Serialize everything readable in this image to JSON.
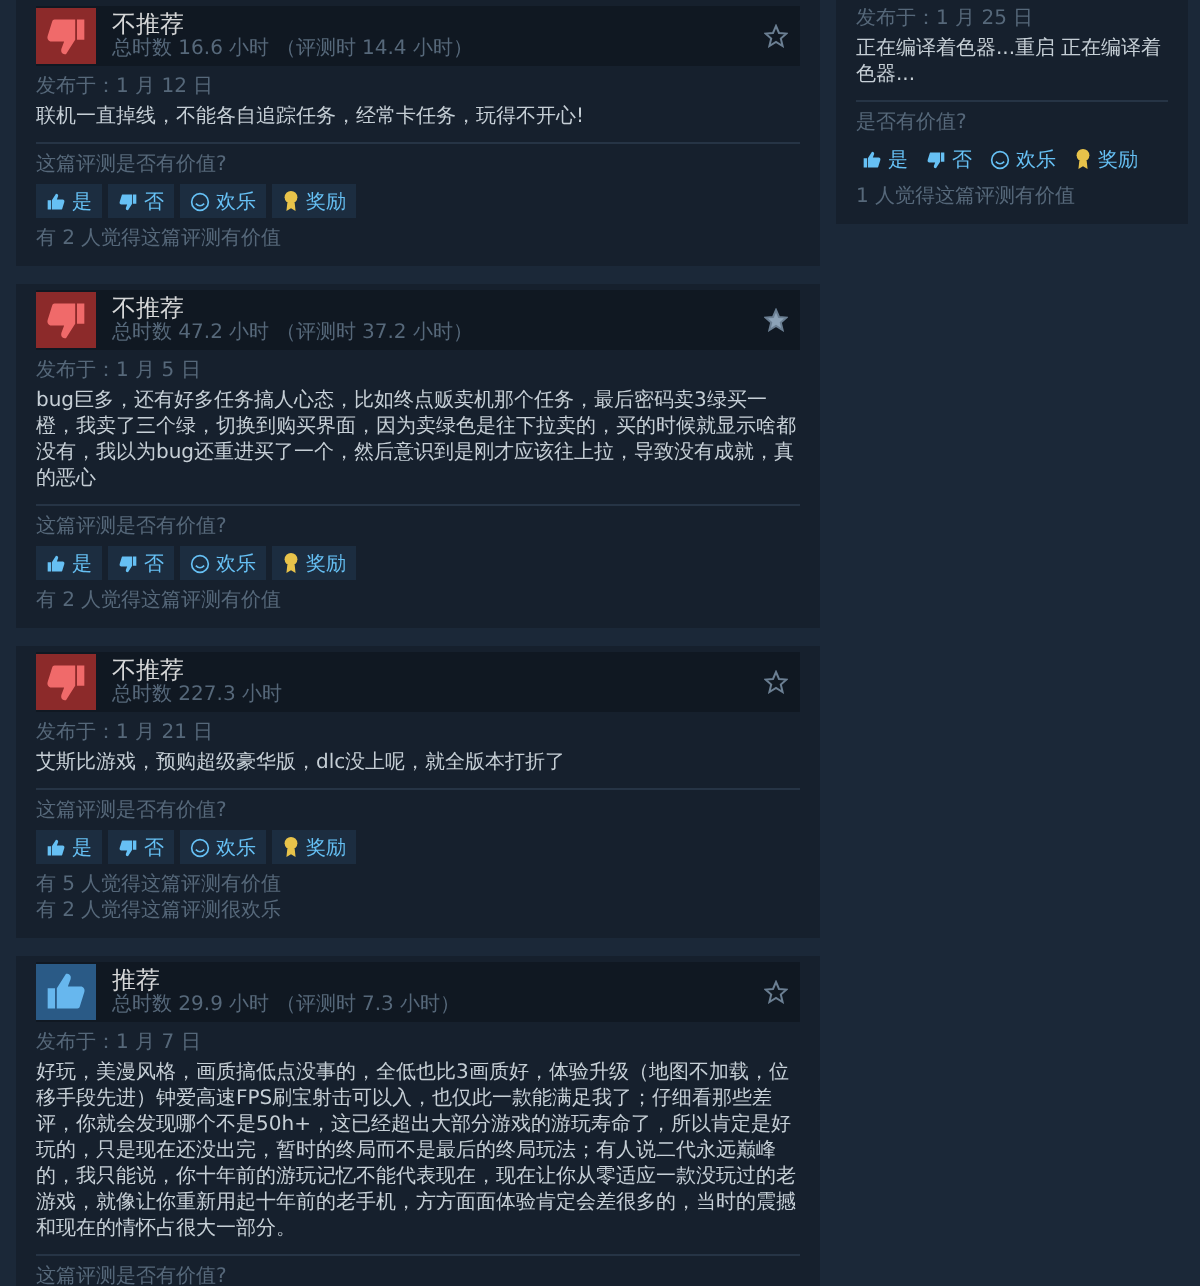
{
  "reviews": [
    {
      "recommended": false,
      "verdict": "不推荐",
      "hours": "总时数 16.6 小时 （评测时 14.4 小时）",
      "starred": false,
      "date": "发布于：1 月 12 日",
      "text": "联机一直掉线，不能各自追踪任务，经常卡任务，玩得不开心!",
      "question": "这篇评测是否有价值?",
      "buttons": [
        "是",
        "否",
        "欢乐",
        "奖励"
      ],
      "counts": [
        "有 2 人觉得这篇评测有价值"
      ]
    },
    {
      "recommended": false,
      "verdict": "不推荐",
      "hours": "总时数 47.2 小时 （评测时 37.2 小时）",
      "starred": true,
      "date": "发布于：1 月 5 日",
      "text": "bug巨多，还有好多任务搞人心态，比如终点贩卖机那个任务，最后密码卖3绿买一橙，我卖了三个绿，切换到购买界面，因为卖绿色是往下拉卖的，买的时候就显示啥都没有，我以为bug还重进买了一个，然后意识到是刚才应该往上拉，导致没有成就，真的恶心",
      "question": "这篇评测是否有价值?",
      "buttons": [
        "是",
        "否",
        "欢乐",
        "奖励"
      ],
      "counts": [
        "有 2 人觉得这篇评测有价值"
      ]
    },
    {
      "recommended": false,
      "verdict": "不推荐",
      "hours": "总时数 227.3 小时",
      "starred": false,
      "date": "发布于：1 月 21 日",
      "text": "艾斯比游戏，预购超级豪华版，dlc没上呢，就全版本打折了",
      "question": "这篇评测是否有价值?",
      "buttons": [
        "是",
        "否",
        "欢乐",
        "奖励"
      ],
      "counts": [
        "有 5 人觉得这篇评测有价值",
        "有 2 人觉得这篇评测很欢乐"
      ]
    },
    {
      "recommended": true,
      "verdict": "推荐",
      "hours": "总时数 29.9 小时 （评测时 7.3 小时）",
      "starred": false,
      "date": "发布于：1 月 7 日",
      "text": "好玩，美漫风格，画质搞低点没事的，全低也比3画质好，体验升级（地图不加载，位移手段先进）钟爱高速FPS刷宝射击可以入，也仅此一款能满足我了；仔细看那些差评，你就会发现哪个不是50h+，这已经超出大部分游戏的游玩寿命了，所以肯定是好玩的，只是现在还没出完，暂时的终局而不是最后的终局玩法；有人说二代永远巅峰的，我只能说，你十年前的游玩记忆不能代表现在，现在让你从零适应一款没玩过的老游戏，就像让你重新用起十年前的老手机，方方面面体验肯定会差很多的，当时的震撼和现在的情怀占很大一部分。",
      "question": "这篇评测是否有价值?"
    }
  ],
  "side_review": {
    "date": "发布于：1 月 25 日",
    "text": "正在编译着色器...重启 正在编译着色器...",
    "question": "是否有价值?",
    "buttons": [
      "是",
      "否",
      "欢乐",
      "奖励"
    ],
    "counts": [
      "1 人觉得这篇评测有价值"
    ]
  }
}
